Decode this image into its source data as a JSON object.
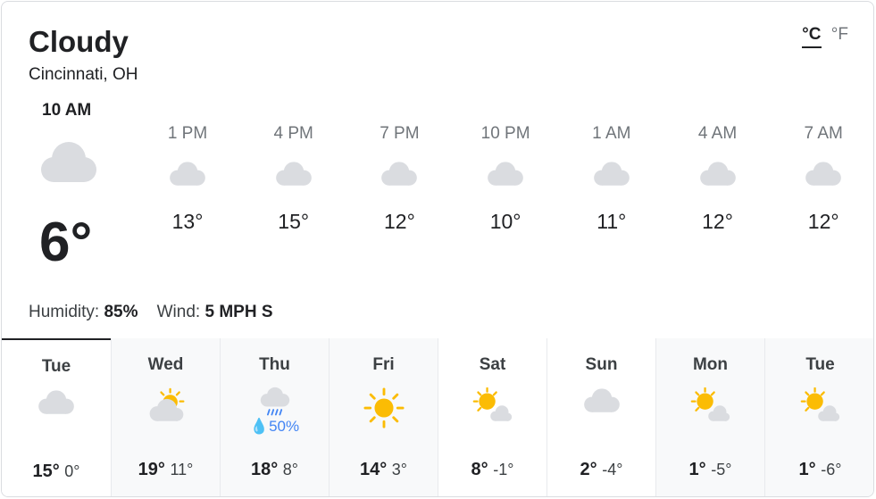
{
  "current": {
    "condition": "Cloudy",
    "location": "Cincinnati, OH",
    "time": "10 AM",
    "temp": "6°",
    "icon": "cloud-icon",
    "humidity_label": "Humidity:",
    "humidity": "85%",
    "wind_label": "Wind:",
    "wind": "5 MPH S"
  },
  "units": {
    "c": "°C",
    "f": "°F"
  },
  "hourly": [
    {
      "time": "1 PM",
      "temp": "13°",
      "icon": "cloud-icon"
    },
    {
      "time": "4 PM",
      "temp": "15°",
      "icon": "cloud-icon"
    },
    {
      "time": "7 PM",
      "temp": "12°",
      "icon": "cloud-icon"
    },
    {
      "time": "10 PM",
      "temp": "10°",
      "icon": "cloud-icon"
    },
    {
      "time": "1 AM",
      "temp": "11°",
      "icon": "cloud-icon"
    },
    {
      "time": "4 AM",
      "temp": "12°",
      "icon": "cloud-icon"
    },
    {
      "time": "7 AM",
      "temp": "12°",
      "icon": "cloud-icon"
    }
  ],
  "daily": [
    {
      "day": "Tue",
      "high": "15°",
      "low": "0°",
      "icon": "cloud-icon",
      "precip": ""
    },
    {
      "day": "Wed",
      "high": "19°",
      "low": "11°",
      "icon": "partly-cloudy-icon",
      "precip": ""
    },
    {
      "day": "Thu",
      "high": "18°",
      "low": "8°",
      "icon": "rain-icon",
      "precip": "50%"
    },
    {
      "day": "Fri",
      "high": "14°",
      "low": "3°",
      "icon": "sun-icon",
      "precip": ""
    },
    {
      "day": "Sat",
      "high": "8°",
      "low": "-1°",
      "icon": "mostly-sunny-icon",
      "precip": ""
    },
    {
      "day": "Sun",
      "high": "2°",
      "low": "-4°",
      "icon": "cloud-icon",
      "precip": ""
    },
    {
      "day": "Mon",
      "high": "1°",
      "low": "-5°",
      "icon": "mostly-sunny-icon",
      "precip": ""
    },
    {
      "day": "Tue",
      "high": "1°",
      "low": "-6°",
      "icon": "mostly-sunny-icon",
      "precip": ""
    }
  ],
  "colors": {
    "sun": "#fbbc04",
    "cloud": "#dadce0",
    "rain": "#4285f4"
  }
}
